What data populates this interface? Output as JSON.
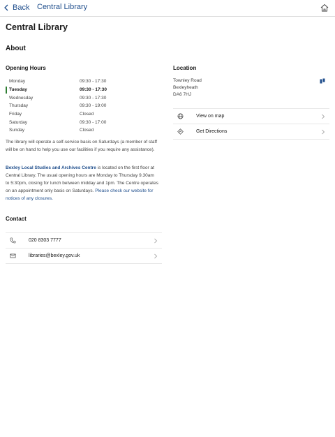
{
  "nav": {
    "back_label": "Back",
    "title": "Central Library"
  },
  "page": {
    "title": "Central Library",
    "about_heading": "About"
  },
  "opening_hours": {
    "heading": "Opening Hours",
    "rows": [
      {
        "day": "Monday",
        "time": "09:30 - 17:30",
        "today": false
      },
      {
        "day": "Tuesday",
        "time": "09:30 - 17:30",
        "today": true
      },
      {
        "day": "Wednesday",
        "time": "09:30 - 17:30",
        "today": false
      },
      {
        "day": "Thursday",
        "time": "09:30 - 19:00",
        "today": false
      },
      {
        "day": "Friday",
        "time": "Closed",
        "today": false
      },
      {
        "day": "Saturday",
        "time": "09:30 - 17:00",
        "today": false
      },
      {
        "day": "Sunday",
        "time": "Closed",
        "today": false
      }
    ],
    "today_color": "#2e7d32"
  },
  "notes": {
    "self_service": "The library will operate a self-service basis on Saturdays (a member of staff will be on hand to help you use our facilities if you require any assistance).",
    "archives_link": "Bexley Local Studies and Archives Centre",
    "archives_text": " is located on the first floor at Central Library. The usual opening hours are Monday to Thursday 9.30am to 5:30pm, closing for lunch between midday and 1pm. The Centre operates on an appointment only basis on Saturdays. ",
    "website_link": "Please check our website for notices of any closures."
  },
  "location": {
    "heading": "Location",
    "address_lines": [
      "Townley Road",
      "Bexleyheath",
      "DA6 7HJ"
    ],
    "pin_icon": "map-pin-icon",
    "actions": [
      {
        "label": "View on map",
        "icon": "globe-icon"
      },
      {
        "label": "Get Directions",
        "icon": "directions-icon"
      }
    ]
  },
  "contact": {
    "heading": "Contact",
    "phone": "020 8303 7777",
    "email": "libraries@bexley.gov.uk"
  },
  "colors": {
    "accent": "#1f4e8c",
    "divider": "#e8e8e8"
  }
}
